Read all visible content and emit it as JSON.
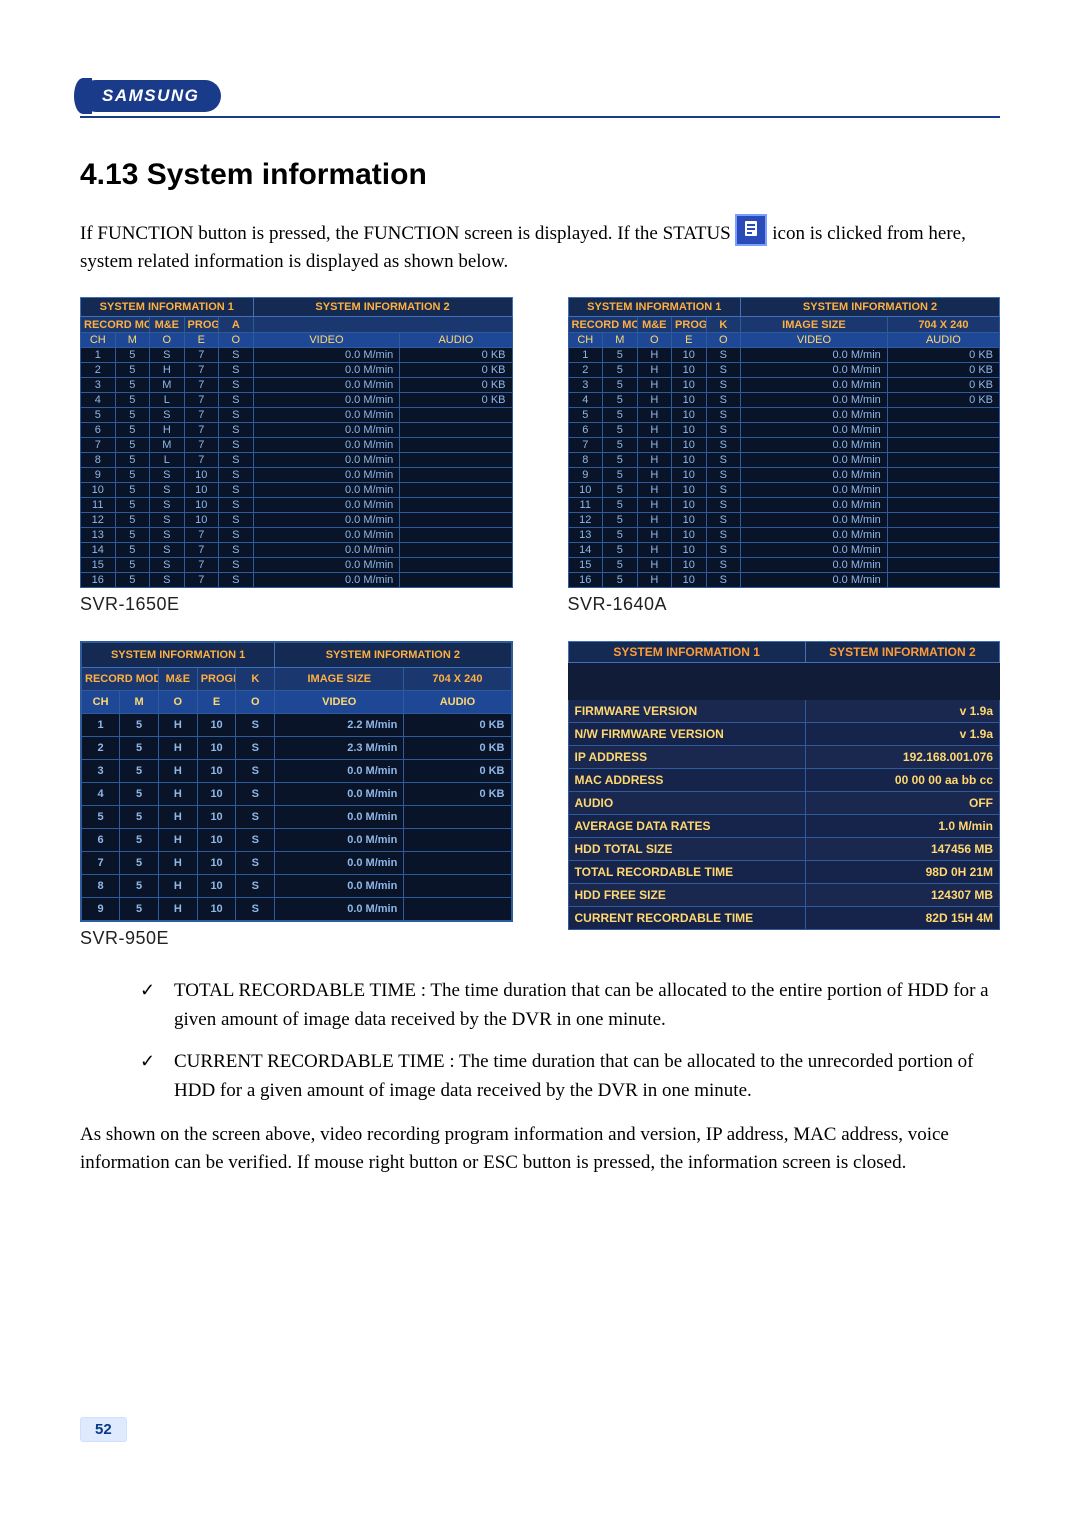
{
  "logo_text": "SAMSUNG",
  "heading": "4.13 System information",
  "intro_a": "If FUNCTION button is pressed, the FUNCTION screen is displayed. If the STATUS ",
  "intro_b": " icon is clicked from here, system related information is displayed as shown below.",
  "models": {
    "m1": "SVR-1650E",
    "m2": "SVR-1640A",
    "m3": "SVR-950E"
  },
  "table_hdr": {
    "tab1": "SYSTEM INFORMATION 1",
    "tab2": "SYSTEM INFORMATION 2",
    "record_mode": "RECORD MODE",
    "me": "M&E",
    "programe": "PROGRAME",
    "a": "A",
    "k": "K",
    "image_size": "IMAGE SIZE",
    "image_size_val": "704 X 240",
    "ch": "CH",
    "m": "M",
    "o": "O",
    "e": "E",
    "o2": "O",
    "video": "VIDEO",
    "audio": "AUDIO"
  },
  "sys_1650E": {
    "rows": [
      {
        "ch": "1",
        "m": "5",
        "o": "S",
        "e": "7",
        "o2": "S",
        "video": "0.0 M/min",
        "audio": "0 KB"
      },
      {
        "ch": "2",
        "m": "5",
        "o": "H",
        "e": "7",
        "o2": "S",
        "video": "0.0 M/min",
        "audio": "0 KB"
      },
      {
        "ch": "3",
        "m": "5",
        "o": "M",
        "e": "7",
        "o2": "S",
        "video": "0.0 M/min",
        "audio": "0 KB"
      },
      {
        "ch": "4",
        "m": "5",
        "o": "L",
        "e": "7",
        "o2": "S",
        "video": "0.0 M/min",
        "audio": "0 KB"
      },
      {
        "ch": "5",
        "m": "5",
        "o": "S",
        "e": "7",
        "o2": "S",
        "video": "0.0 M/min",
        "audio": ""
      },
      {
        "ch": "6",
        "m": "5",
        "o": "H",
        "e": "7",
        "o2": "S",
        "video": "0.0 M/min",
        "audio": ""
      },
      {
        "ch": "7",
        "m": "5",
        "o": "M",
        "e": "7",
        "o2": "S",
        "video": "0.0 M/min",
        "audio": ""
      },
      {
        "ch": "8",
        "m": "5",
        "o": "L",
        "e": "7",
        "o2": "S",
        "video": "0.0 M/min",
        "audio": ""
      },
      {
        "ch": "9",
        "m": "5",
        "o": "S",
        "e": "10",
        "o2": "S",
        "video": "0.0 M/min",
        "audio": ""
      },
      {
        "ch": "10",
        "m": "5",
        "o": "S",
        "e": "10",
        "o2": "S",
        "video": "0.0 M/min",
        "audio": ""
      },
      {
        "ch": "11",
        "m": "5",
        "o": "S",
        "e": "10",
        "o2": "S",
        "video": "0.0 M/min",
        "audio": ""
      },
      {
        "ch": "12",
        "m": "5",
        "o": "S",
        "e": "10",
        "o2": "S",
        "video": "0.0 M/min",
        "audio": ""
      },
      {
        "ch": "13",
        "m": "5",
        "o": "S",
        "e": "7",
        "o2": "S",
        "video": "0.0 M/min",
        "audio": ""
      },
      {
        "ch": "14",
        "m": "5",
        "o": "S",
        "e": "7",
        "o2": "S",
        "video": "0.0 M/min",
        "audio": ""
      },
      {
        "ch": "15",
        "m": "5",
        "o": "S",
        "e": "7",
        "o2": "S",
        "video": "0.0 M/min",
        "audio": ""
      },
      {
        "ch": "16",
        "m": "5",
        "o": "S",
        "e": "7",
        "o2": "S",
        "video": "0.0 M/min",
        "audio": ""
      }
    ]
  },
  "sys_1640A": {
    "rows": [
      {
        "ch": "1",
        "m": "5",
        "o": "H",
        "e": "10",
        "o2": "S",
        "video": "0.0 M/min",
        "audio": "0 KB"
      },
      {
        "ch": "2",
        "m": "5",
        "o": "H",
        "e": "10",
        "o2": "S",
        "video": "0.0 M/min",
        "audio": "0 KB"
      },
      {
        "ch": "3",
        "m": "5",
        "o": "H",
        "e": "10",
        "o2": "S",
        "video": "0.0 M/min",
        "audio": "0 KB"
      },
      {
        "ch": "4",
        "m": "5",
        "o": "H",
        "e": "10",
        "o2": "S",
        "video": "0.0 M/min",
        "audio": "0 KB"
      },
      {
        "ch": "5",
        "m": "5",
        "o": "H",
        "e": "10",
        "o2": "S",
        "video": "0.0 M/min",
        "audio": ""
      },
      {
        "ch": "6",
        "m": "5",
        "o": "H",
        "e": "10",
        "o2": "S",
        "video": "0.0 M/min",
        "audio": ""
      },
      {
        "ch": "7",
        "m": "5",
        "o": "H",
        "e": "10",
        "o2": "S",
        "video": "0.0 M/min",
        "audio": ""
      },
      {
        "ch": "8",
        "m": "5",
        "o": "H",
        "e": "10",
        "o2": "S",
        "video": "0.0 M/min",
        "audio": ""
      },
      {
        "ch": "9",
        "m": "5",
        "o": "H",
        "e": "10",
        "o2": "S",
        "video": "0.0 M/min",
        "audio": ""
      },
      {
        "ch": "10",
        "m": "5",
        "o": "H",
        "e": "10",
        "o2": "S",
        "video": "0.0 M/min",
        "audio": ""
      },
      {
        "ch": "11",
        "m": "5",
        "o": "H",
        "e": "10",
        "o2": "S",
        "video": "0.0 M/min",
        "audio": ""
      },
      {
        "ch": "12",
        "m": "5",
        "o": "H",
        "e": "10",
        "o2": "S",
        "video": "0.0 M/min",
        "audio": ""
      },
      {
        "ch": "13",
        "m": "5",
        "o": "H",
        "e": "10",
        "o2": "S",
        "video": "0.0 M/min",
        "audio": ""
      },
      {
        "ch": "14",
        "m": "5",
        "o": "H",
        "e": "10",
        "o2": "S",
        "video": "0.0 M/min",
        "audio": ""
      },
      {
        "ch": "15",
        "m": "5",
        "o": "H",
        "e": "10",
        "o2": "S",
        "video": "0.0 M/min",
        "audio": ""
      },
      {
        "ch": "16",
        "m": "5",
        "o": "H",
        "e": "10",
        "o2": "S",
        "video": "0.0 M/min",
        "audio": ""
      }
    ]
  },
  "sys_950E": {
    "rows": [
      {
        "ch": "1",
        "m": "5",
        "o": "H",
        "e": "10",
        "o2": "S",
        "video": "2.2 M/min",
        "audio": "0 KB"
      },
      {
        "ch": "2",
        "m": "5",
        "o": "H",
        "e": "10",
        "o2": "S",
        "video": "2.3 M/min",
        "audio": "0 KB"
      },
      {
        "ch": "3",
        "m": "5",
        "o": "H",
        "e": "10",
        "o2": "S",
        "video": "0.0 M/min",
        "audio": "0 KB"
      },
      {
        "ch": "4",
        "m": "5",
        "o": "H",
        "e": "10",
        "o2": "S",
        "video": "0.0 M/min",
        "audio": "0 KB"
      },
      {
        "ch": "5",
        "m": "5",
        "o": "H",
        "e": "10",
        "o2": "S",
        "video": "0.0 M/min",
        "audio": ""
      },
      {
        "ch": "6",
        "m": "5",
        "o": "H",
        "e": "10",
        "o2": "S",
        "video": "0.0 M/min",
        "audio": ""
      },
      {
        "ch": "7",
        "m": "5",
        "o": "H",
        "e": "10",
        "o2": "S",
        "video": "0.0 M/min",
        "audio": ""
      },
      {
        "ch": "8",
        "m": "5",
        "o": "H",
        "e": "10",
        "o2": "S",
        "video": "0.0 M/min",
        "audio": ""
      },
      {
        "ch": "9",
        "m": "5",
        "o": "H",
        "e": "10",
        "o2": "S",
        "video": "0.0 M/min",
        "audio": ""
      }
    ]
  },
  "panel2": {
    "rows": [
      {
        "k": "FIRMWARE VERSION",
        "v": "v 1.9a"
      },
      {
        "k": "N/W FIRMWARE VERSION",
        "v": "v 1.9a"
      },
      {
        "k": "IP ADDRESS",
        "v": "192.168.001.076"
      },
      {
        "k": "MAC ADDRESS",
        "v": "00 00 00 aa bb cc"
      },
      {
        "k": "AUDIO",
        "v": "OFF"
      },
      {
        "k": "AVERAGE DATA RATES",
        "v": "1.0 M/min"
      },
      {
        "k": "HDD TOTAL SIZE",
        "v": "147456 MB"
      },
      {
        "k": "TOTAL RECORDABLE TIME",
        "v": "98D    0H   21M"
      },
      {
        "k": "HDD FREE SIZE",
        "v": "124307 MB"
      },
      {
        "k": "CURRENT RECORDABLE TIME",
        "v": "82D    15H    4M"
      }
    ]
  },
  "bullet1": "TOTAL RECORDABLE TIME : The time duration that can be allocated to the entire portion of   HDD for a given amount of image data received by the DVR in one minute.",
  "bullet2": "CURRENT RECORDABLE TIME : The time duration that can be allocated to the unrecorded portion of HDD for a given amount of image data received by the DVR in one minute.",
  "closing": "As shown on the screen above, video recording program information and version, IP address, MAC address, voice information can be verified. If mouse right button or ESC button is pressed, the information screen is closed.",
  "page_number": "52"
}
